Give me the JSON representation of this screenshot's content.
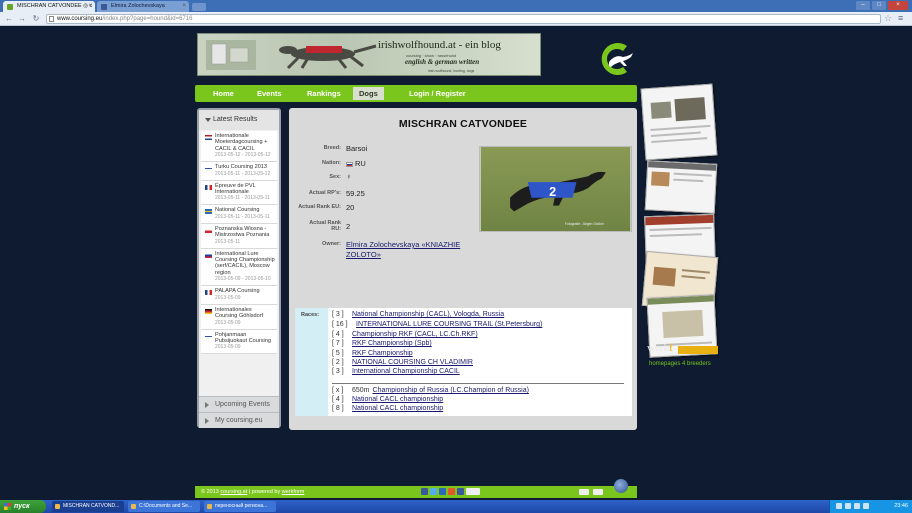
{
  "browser": {
    "tabs": [
      {
        "title": "MISCHRAN CATVONDEE ◎ c",
        "active": true
      },
      {
        "title": "Elmira Zolochevskaya",
        "active": false
      }
    ],
    "url_host": "www.coursing.eu",
    "url_path": "/index.php?page=hound&id=6716"
  },
  "header": {
    "blog_title": "irishwolfhound.at - ein blog",
    "blog_sub": "coursing · show · rassehund",
    "blog_tagline": "english & german written",
    "blog_sub2": "irish wolfhound, hunting, dogs"
  },
  "nav": {
    "items": [
      {
        "label": "Home"
      },
      {
        "label": "Events"
      },
      {
        "label": "Rankings"
      },
      {
        "label": "Dogs"
      },
      {
        "label": "Login / Register"
      }
    ]
  },
  "sidebar": {
    "heading": "Latest Results",
    "items": [
      {
        "title": "Internationale Moeierdagcoursing + CACIL & CACIL",
        "date": "2013-05-12 - 2013-05-12",
        "flag": "nl"
      },
      {
        "title": "Turku Coursing 2013",
        "date": "2013-05-11 - 2013-05-12",
        "flag": "fi"
      },
      {
        "title": "Épreuve de PVL Internationale",
        "date": "2013-05-11 - 2013-05-11",
        "flag": "fr"
      },
      {
        "title": "National Coursing",
        "date": "2013-05-11 - 2013-05-11",
        "flag": "se"
      },
      {
        "title": "Poznanska Wiosna - Mistrzostwa Poznania",
        "date": "2013-05-11",
        "flag": "pl"
      },
      {
        "title": "International Lure Coursing Championship (serf/CACIL), Moscow region",
        "date": "2013-05-09 - 2013-05-10",
        "flag": "ru"
      },
      {
        "title": "PALAPA Coursing",
        "date": "2013-05-09",
        "flag": "fr"
      },
      {
        "title": "Internationales Coursing Göhlsdorf",
        "date": "2013-05-09",
        "flag": "de"
      },
      {
        "title": "Pohjanmaan Pubsijuokaut Coursing",
        "date": "2013-05-09",
        "flag": "fi"
      }
    ],
    "upcoming": "Upcoming Events",
    "my": "My coursing.eu"
  },
  "dog": {
    "name": "MISCHRAN CATVONDEE",
    "labels": {
      "breed": "Breed:",
      "nation": "Nation:",
      "sex": "Sex:",
      "rp": "Actual RP's:",
      "rank_eu": "Actual Rank EU:",
      "rank_ru": "Actual Rank RU:",
      "owner": "Owner:"
    },
    "breed": "Barsoi",
    "nation": "RU",
    "sex_symbol": "♀",
    "rp": "59.25",
    "rank_eu": "20",
    "rank_ru": "2",
    "owner": "Elmira Zolochevskaya «KNIAZHIE ZOLOTO»",
    "photo_number": "2",
    "photo_caption": "Fotografie: Jürgen Grübel"
  },
  "races": {
    "label": "Races:",
    "list": [
      {
        "place": "[ 3 ]",
        "name": "National Championship (CACL), Vologda, Russia"
      },
      {
        "place": "[ 16 ]",
        "name": "INTERNATIONAL LURE COURSING TRAIL (St.Petersburg)"
      },
      {
        "place": "[ 4 ]",
        "name": "Championship RKF (CACL, LC.Ch.RKF)"
      },
      {
        "place": "[ 7 ]",
        "name": "RKF Championship (Spb)"
      },
      {
        "place": "[ 5 ]",
        "name": "RKF Championship"
      },
      {
        "place": "[ 2 ]",
        "name": "NATIONAL COURSING CH VLADIMIR"
      },
      {
        "place": "[ 3 ]",
        "name": "International Championship CACIL"
      }
    ],
    "list2": [
      {
        "place": "[ x ]",
        "extra": "650m",
        "name": "Championship of Russia (LC.Champion of Russia)"
      },
      {
        "place": "[ 4 ]",
        "name": "National CACL championship"
      },
      {
        "place": "[ 8 ]",
        "name": "National CACL championship"
      }
    ]
  },
  "werk": {
    "brand_a": "werk",
    "brand_b": "f",
    "sub": "homepages 4 breeders"
  },
  "footer": {
    "copyright": "© 2013",
    "site": "coursing.at",
    "powered": "| powered by",
    "by": "werkform"
  },
  "taskbar": {
    "start": "пуск",
    "tasks": [
      "MISCHRAN CATVOND...",
      "C:\\Documents and Se...",
      "переносный региона..."
    ],
    "clock": "23:46"
  }
}
